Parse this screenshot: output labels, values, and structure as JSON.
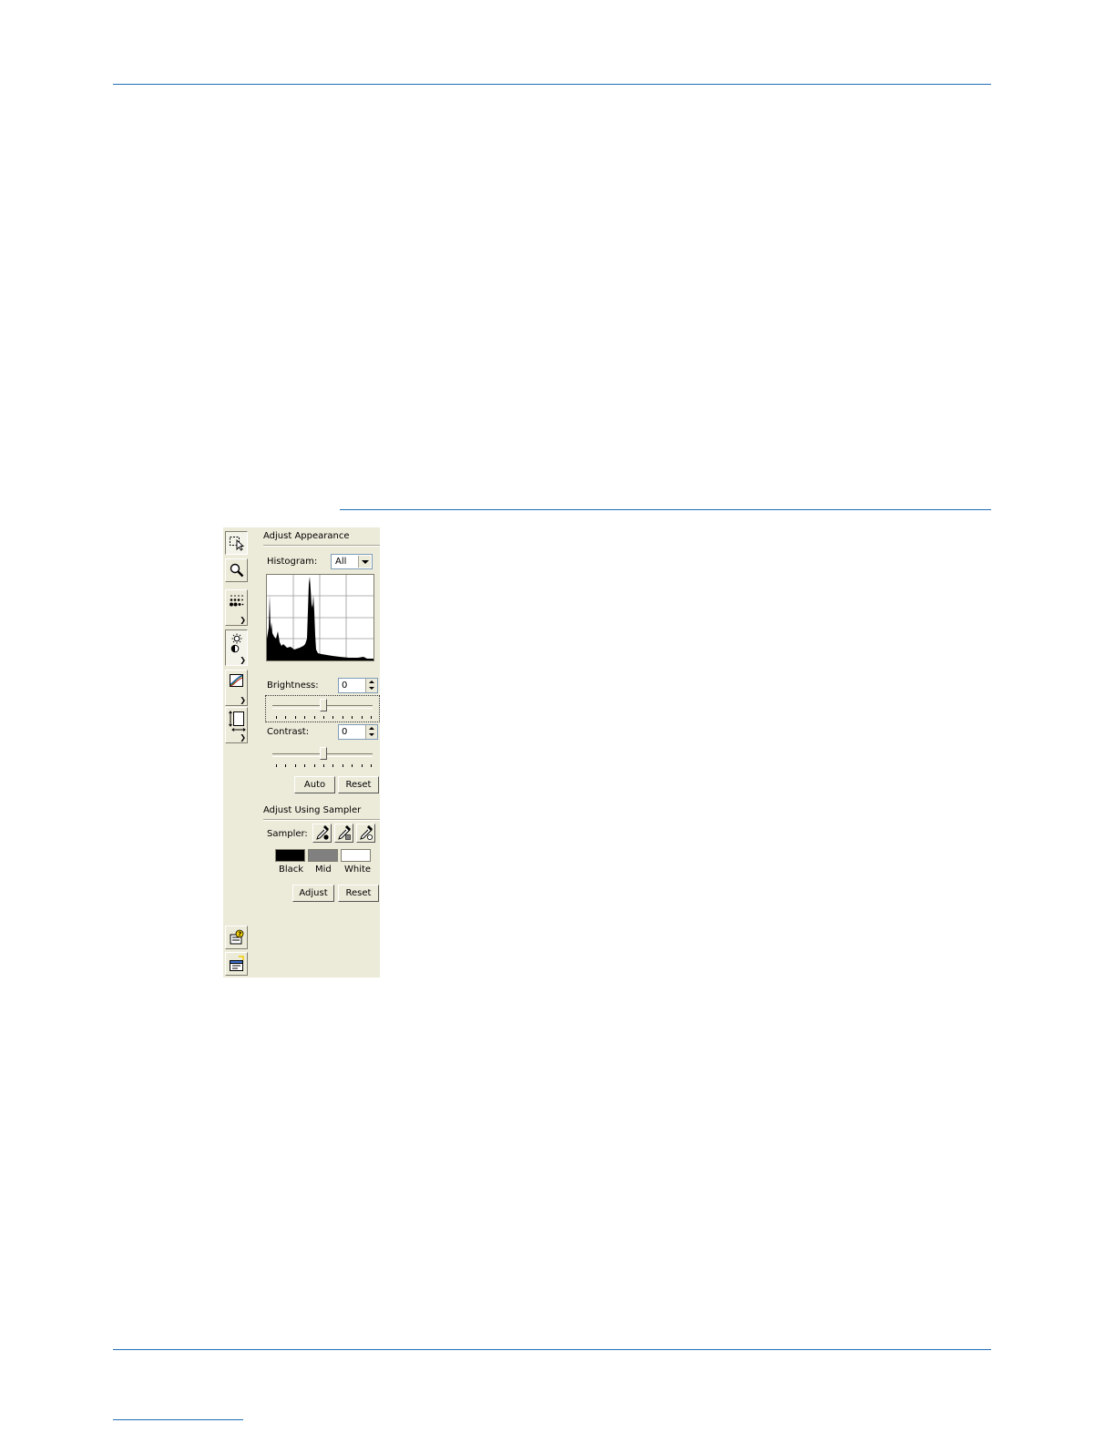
{
  "panel": {
    "adjust_appearance": {
      "title": "Adjust Appearance",
      "histogram_label": "Histogram:",
      "histogram_channel": "All",
      "brightness_label": "Brightness:",
      "brightness_value": "0",
      "contrast_label": "Contrast:",
      "contrast_value": "0",
      "auto_button": "Auto",
      "reset_button": "Reset"
    },
    "adjust_using_sampler": {
      "title": "Adjust Using Sampler",
      "sampler_label": "Sampler:",
      "swatches": [
        {
          "label": "Black",
          "color": "#000000"
        },
        {
          "label": "Mid",
          "color": "#808080"
        },
        {
          "label": "White",
          "color": "#ffffff"
        }
      ],
      "adjust_button": "Adjust",
      "reset_button": "Reset"
    },
    "toolbar_icons": [
      "select-region-icon",
      "zoom-icon",
      "halftone-icon",
      "brightness-contrast-icon",
      "color-curves-icon",
      "page-size-icon",
      "help-icon",
      "settings-icon"
    ]
  }
}
